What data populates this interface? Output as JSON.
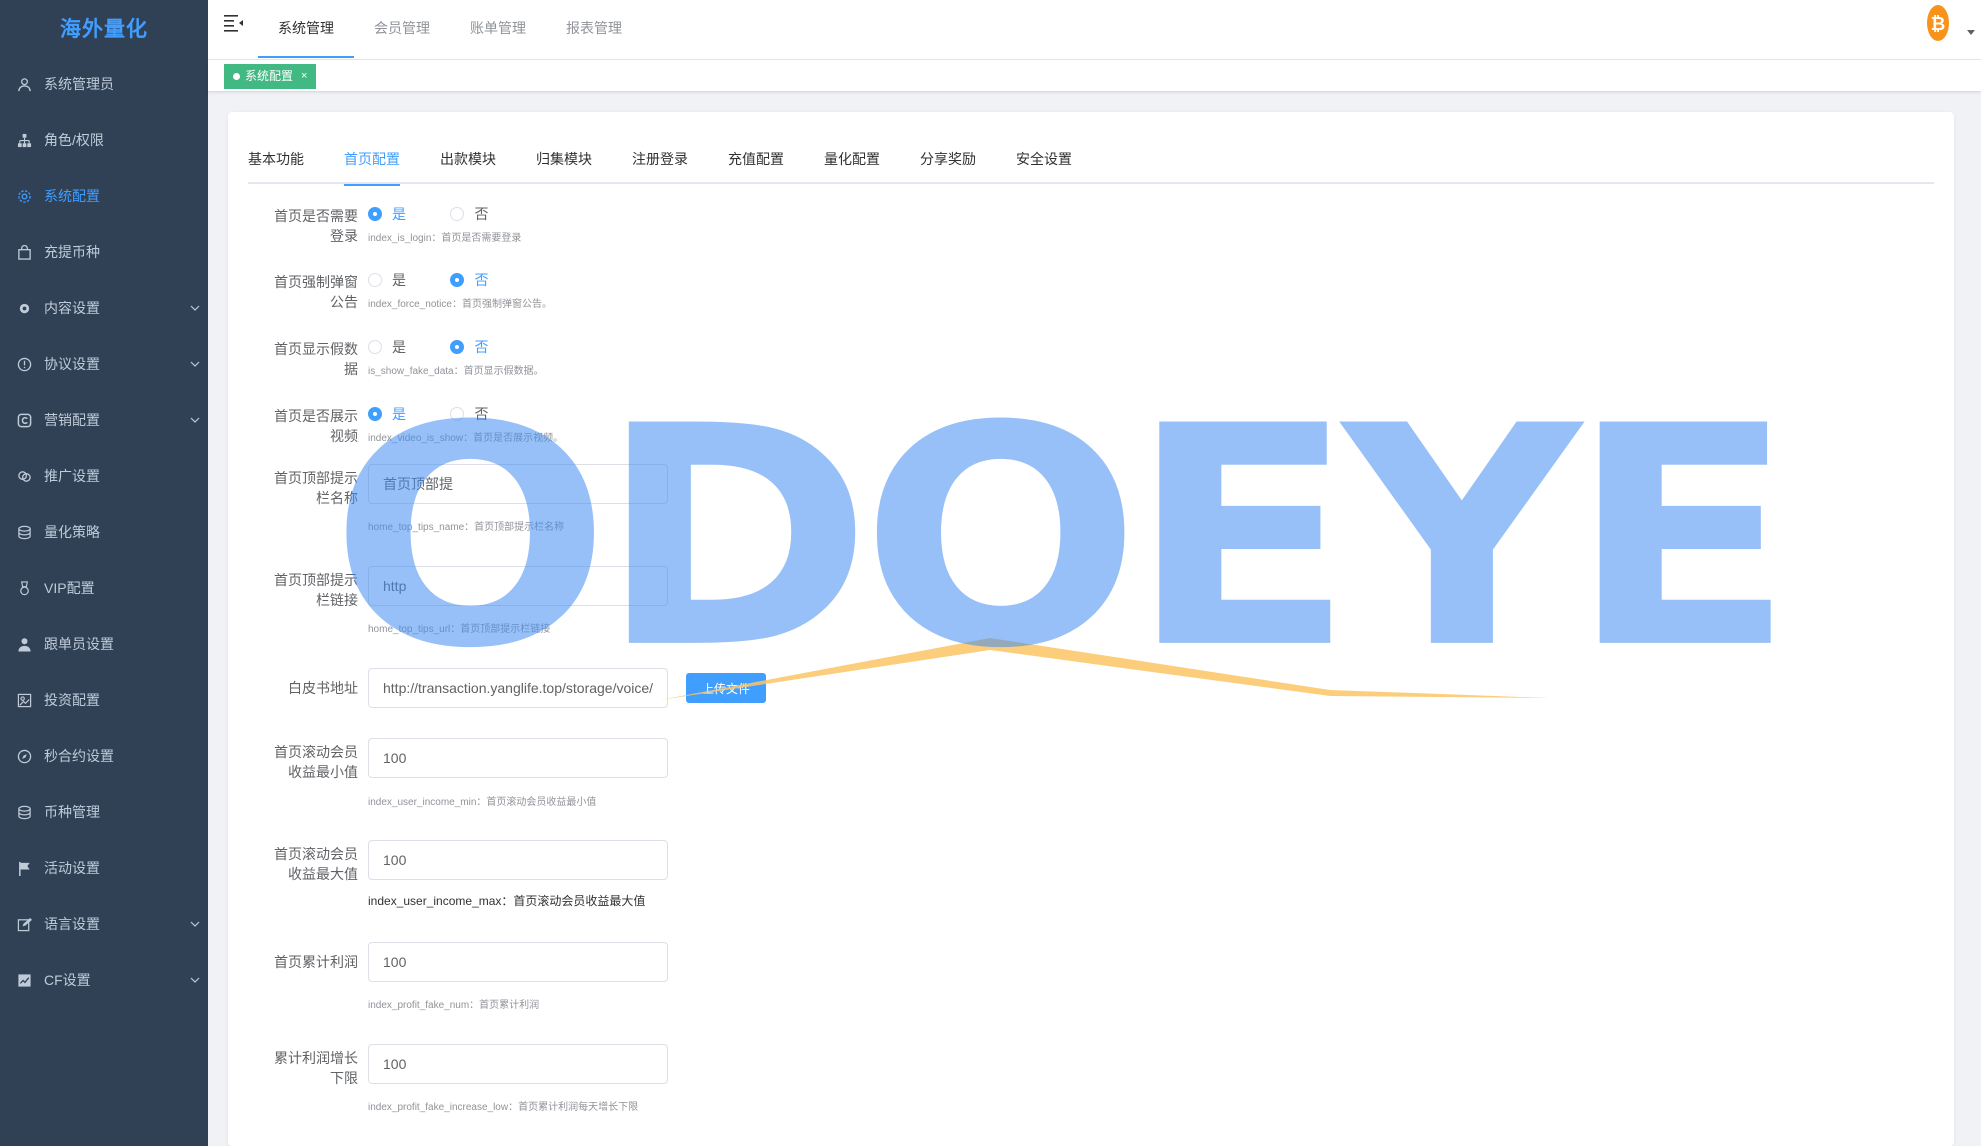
{
  "sidebar": {
    "logo": "海外量化",
    "items": [
      {
        "label": "系统管理员",
        "icon": "user-icon",
        "has_arrow": false,
        "active": false
      },
      {
        "label": "角色/权限",
        "icon": "org-tree-icon",
        "has_arrow": false,
        "active": false
      },
      {
        "label": "系统配置",
        "icon": "gear-icon",
        "has_arrow": false,
        "active": true
      },
      {
        "label": "充提币种",
        "icon": "bag-icon",
        "has_arrow": false,
        "active": false
      },
      {
        "label": "内容设置",
        "icon": "cog-icon",
        "has_arrow": true,
        "active": false
      },
      {
        "label": "协议设置",
        "icon": "info-circle-icon",
        "has_arrow": true,
        "active": false
      },
      {
        "label": "营销配置",
        "icon": "marketing-icon",
        "has_arrow": true,
        "active": false
      },
      {
        "label": "推广设置",
        "icon": "link-icon",
        "has_arrow": false,
        "active": false
      },
      {
        "label": "量化策略",
        "icon": "database-icon",
        "has_arrow": false,
        "active": false
      },
      {
        "label": "VIP配置",
        "icon": "medal-icon",
        "has_arrow": false,
        "active": false
      },
      {
        "label": "跟单员设置",
        "icon": "person-icon",
        "has_arrow": false,
        "active": false
      },
      {
        "label": "投资配置",
        "icon": "invest-icon",
        "has_arrow": false,
        "active": false
      },
      {
        "label": "秒合约设置",
        "icon": "compass-icon",
        "has_arrow": false,
        "active": false
      },
      {
        "label": "币种管理",
        "icon": "coins-icon",
        "has_arrow": false,
        "active": false
      },
      {
        "label": "活动设置",
        "icon": "flag-icon",
        "has_arrow": false,
        "active": false
      },
      {
        "label": "语言设置",
        "icon": "edit-icon",
        "has_arrow": true,
        "active": false
      },
      {
        "label": "CF设置",
        "icon": "chart-icon",
        "has_arrow": true,
        "active": false
      }
    ]
  },
  "header": {
    "tabs": [
      {
        "label": "系统管理",
        "active": true
      },
      {
        "label": "会员管理",
        "active": false
      },
      {
        "label": "账单管理",
        "active": false
      },
      {
        "label": "报表管理",
        "active": false
      }
    ]
  },
  "tagsbar": {
    "tag_label": "系统配置",
    "close_glyph": "×"
  },
  "tabs": [
    {
      "label": "基本功能",
      "active": false
    },
    {
      "label": "首页配置",
      "active": true
    },
    {
      "label": "出款模块",
      "active": false
    },
    {
      "label": "归集模块",
      "active": false
    },
    {
      "label": "注册登录",
      "active": false
    },
    {
      "label": "充值配置",
      "active": false
    },
    {
      "label": "量化配置",
      "active": false
    },
    {
      "label": "分享奖励",
      "active": false
    },
    {
      "label": "安全设置",
      "active": false
    }
  ],
  "form": {
    "index_is_login": {
      "label_line1": "首页是否需要",
      "label_line2": "登录",
      "yes": "是",
      "no": "否",
      "value": "yes",
      "hint": "index_is_login：首页是否需要登录"
    },
    "index_force_notice": {
      "label_line1": "首页强制弹窗",
      "label_line2": "公告",
      "yes": "是",
      "no": "否",
      "value": "no",
      "hint": "index_force_notice：首页强制弹窗公告。"
    },
    "is_show_fake_data": {
      "label_line1": "首页显示假数",
      "label_line2": "据",
      "yes": "是",
      "no": "否",
      "value": "no",
      "hint": "is_show_fake_data：首页显示假数据。"
    },
    "index_video_is_show": {
      "label_line1": "首页是否展示",
      "label_line2": "视频",
      "yes": "是",
      "no": "否",
      "value": "yes",
      "hint": "index_video_is_show：首页是否展示视频。"
    },
    "home_top_tips_name": {
      "label_line1": "首页顶部提示",
      "label_line2": "栏名称",
      "value": "首页顶部提",
      "hint": "home_top_tips_name：首页顶部提示栏名称"
    },
    "home_top_tips_url": {
      "label_line1": "首页顶部提示",
      "label_line2": "栏链接",
      "value": "http",
      "hint": "home_top_tips_url：首页顶部提示栏链接"
    },
    "whitepaper": {
      "label": "白皮书地址",
      "value": "http://transaction.yanglife.top/storage/voice/",
      "upload_label": "上传文件"
    },
    "index_user_income_min": {
      "label_line1": "首页滚动会员",
      "label_line2": "收益最小值",
      "value": "100",
      "hint": "index_user_income_min：首页滚动会员收益最小值"
    },
    "index_user_income_max": {
      "label_line1": "首页滚动会员",
      "label_line2": "收益最大值",
      "value": "100",
      "hint": "index_user_income_max：首页滚动会员收益最大值"
    },
    "index_profit_fake_num": {
      "label": "首页累计利润",
      "value": "100",
      "hint": "index_profit_fake_num：首页累计利润"
    },
    "index_profit_fake_increase_low": {
      "label_line1": "累计利润增长",
      "label_line2": "下限",
      "value": "100",
      "hint": "index_profit_fake_increase_low：首页累计利润每天增长下限"
    }
  },
  "watermark": {
    "text": "ODOEYE"
  },
  "colors": {
    "primary": "#409eff",
    "sidebar_bg": "#304156",
    "tag_green": "#42b983",
    "bitcoin_orange": "#f7931a"
  }
}
